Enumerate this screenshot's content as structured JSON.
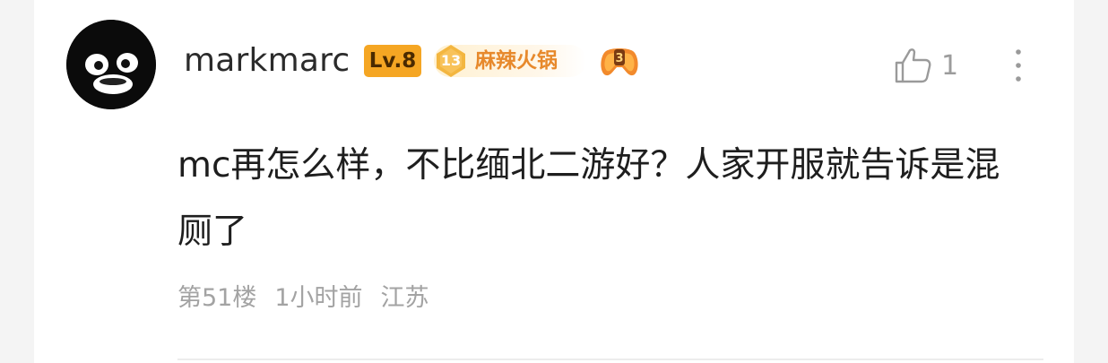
{
  "comment": {
    "user": {
      "name": "markmarc",
      "level": "Lv.8",
      "fan_badge": {
        "level": "13",
        "name": "麻辣火锅",
        "color": "#f5a623"
      },
      "medal": {
        "label": "3",
        "icon": "gamepad-medal-icon"
      },
      "avatar_icon": "penguin-avatar"
    },
    "like": {
      "icon": "thumbs-up-icon",
      "count": "1"
    },
    "more_icon": "vertical-ellipsis-icon",
    "text": "mc再怎么样，不比缅北二游好？人家开服就告诉是混厕了",
    "meta": {
      "floor": "第51楼",
      "time": "1小时前",
      "location": "江苏"
    }
  }
}
